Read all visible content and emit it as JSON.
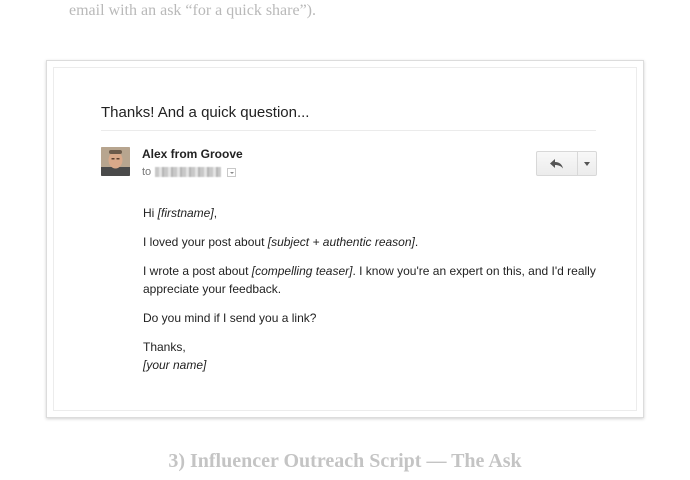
{
  "intro_text": "email with an ask “for a quick share”).",
  "email": {
    "subject": "Thanks! And a quick question...",
    "sender_name": "Alex from Groove",
    "to_prefix": "to",
    "body": {
      "greeting_prefix": "Hi ",
      "greeting_placeholder": "[firstname]",
      "greeting_suffix": ",",
      "line1_prefix": "I loved your post about ",
      "line1_placeholder": "[subject + authentic reason]",
      "line1_suffix": ".",
      "line2_prefix": "I wrote a post about ",
      "line2_placeholder": "[compelling teaser]",
      "line2_suffix": ". I know you're an expert on this, and I'd really appreciate your feedback.",
      "line3": "Do you mind if I send you a link?",
      "signoff": "Thanks,",
      "signature_placeholder": "[your name]"
    },
    "icons": {
      "reply": "reply-arrow-icon",
      "more": "chevron-down-icon",
      "recipient_details": "caret-down-icon",
      "avatar": "avatar"
    }
  },
  "caption": "3) Influencer Outreach Script — The Ask"
}
